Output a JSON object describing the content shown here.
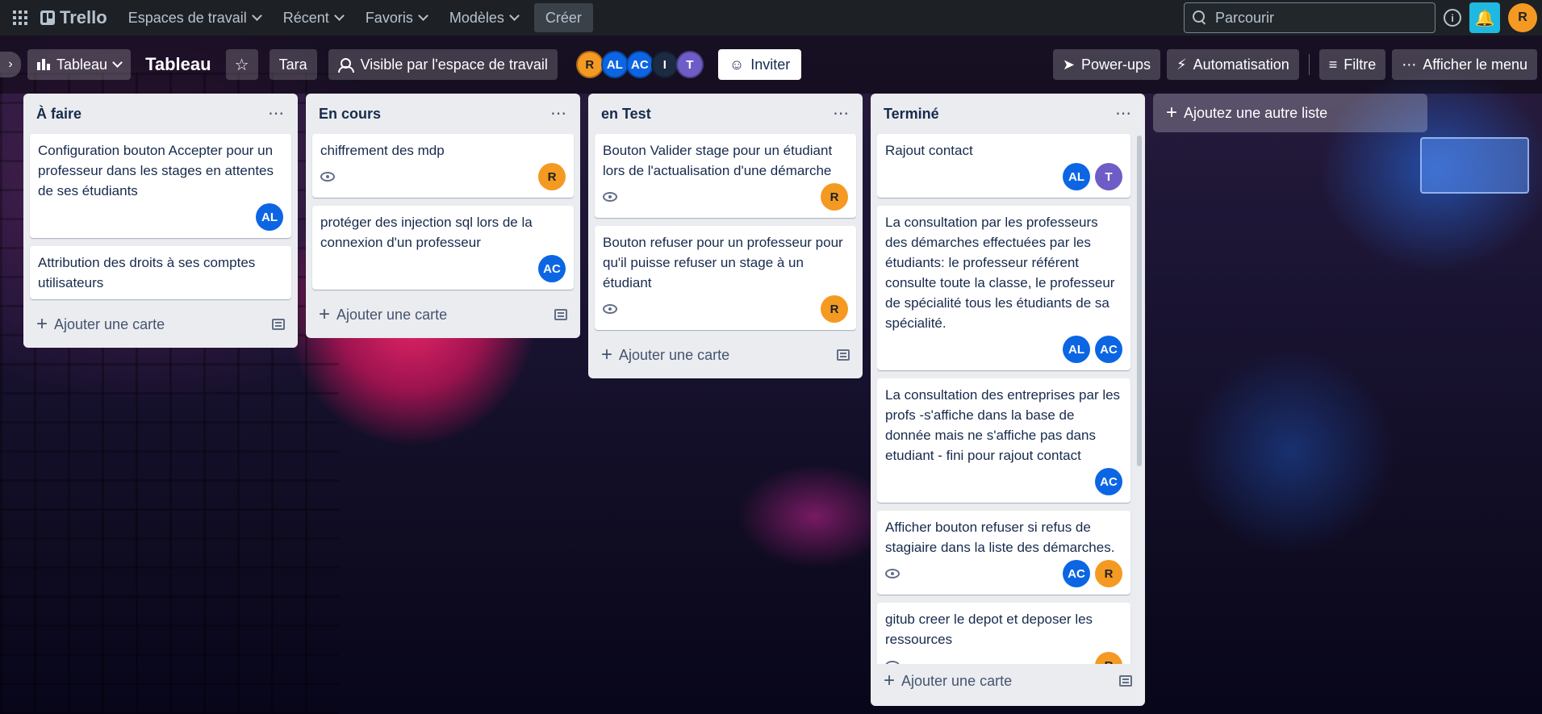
{
  "topbar": {
    "logo": "Trello",
    "nav": [
      {
        "label": "Espaces de travail"
      },
      {
        "label": "Récent"
      },
      {
        "label": "Favoris"
      },
      {
        "label": "Modèles"
      }
    ],
    "create_label": "Créer",
    "search_value": "Parcourir",
    "user_initial": "R",
    "bell_color": "#1fb8e0"
  },
  "boardbar": {
    "view_label": "Tableau",
    "board_title": "Tableau",
    "workspace_label": "Tara",
    "visibility_label": "Visible par l'espace de travail",
    "members": [
      {
        "initials": "R",
        "color": "orange"
      },
      {
        "initials": "AL",
        "color": "blue"
      },
      {
        "initials": "AC",
        "color": "blue"
      },
      {
        "initials": "I",
        "color": "navy"
      },
      {
        "initials": "T",
        "color": "purple"
      }
    ],
    "invite_label": "Inviter",
    "powerups_label": "Power-ups",
    "automation_label": "Automatisation",
    "filter_label": "Filtre",
    "menu_label": "Afficher le menu"
  },
  "lists": [
    {
      "title": "À faire",
      "cards": [
        {
          "text": "Configuration bouton Accepter pour un professeur dans les stages en attentes de ses étudiants",
          "watch": false,
          "members": [
            {
              "initials": "AL",
              "color": "blue"
            }
          ]
        },
        {
          "text": "Attribution des droits à ses comptes utilisateurs",
          "watch": false,
          "members": []
        }
      ],
      "add_card_label": "Ajouter une carte"
    },
    {
      "title": "En cours",
      "cards": [
        {
          "text": "chiffrement des mdp",
          "watch": true,
          "members": [
            {
              "initials": "R",
              "color": "orange"
            }
          ]
        },
        {
          "text": "protéger des injection sql lors de la connexion d'un professeur",
          "watch": false,
          "members": [
            {
              "initials": "AC",
              "color": "blue"
            }
          ]
        }
      ],
      "add_card_label": "Ajouter une carte"
    },
    {
      "title": "en Test",
      "cards": [
        {
          "text": "Bouton Valider stage pour un étudiant lors de l'actualisation d'une démarche",
          "watch": true,
          "members": [
            {
              "initials": "R",
              "color": "orange"
            }
          ]
        },
        {
          "text": "Bouton refuser pour un professeur pour qu'il puisse refuser un stage à un étudiant",
          "watch": true,
          "members": [
            {
              "initials": "R",
              "color": "orange"
            }
          ]
        }
      ],
      "add_card_label": "Ajouter une carte"
    },
    {
      "title": "Terminé",
      "cards": [
        {
          "text": "Rajout contact",
          "watch": false,
          "members": [
            {
              "initials": "AL",
              "color": "blue"
            },
            {
              "initials": "T",
              "color": "purple"
            }
          ]
        },
        {
          "text": "La consultation par les professeurs des démarches effectuées par les étudiants: le professeur référent consulte toute la classe, le professeur de spécialité tous les étudiants de sa spécialité.",
          "watch": false,
          "members": [
            {
              "initials": "AL",
              "color": "blue"
            },
            {
              "initials": "AC",
              "color": "blue"
            }
          ]
        },
        {
          "text": "La consultation des entreprises par les profs -s'affiche dans la base de donnée mais ne s'affiche pas dans etudiant - fini pour rajout contact",
          "watch": false,
          "members": [
            {
              "initials": "AC",
              "color": "blue"
            }
          ]
        },
        {
          "text": "Afficher bouton refuser si refus de stagiaire dans la liste des démarches.",
          "watch": true,
          "members": [
            {
              "initials": "AC",
              "color": "blue"
            },
            {
              "initials": "R",
              "color": "orange"
            }
          ]
        },
        {
          "text": "gitub creer le depot et deposer les ressources",
          "watch": true,
          "members": [
            {
              "initials": "R",
              "color": "orange"
            }
          ]
        }
      ],
      "add_card_label": "Ajouter une carte"
    }
  ],
  "add_list_label": "Ajoutez une autre liste"
}
